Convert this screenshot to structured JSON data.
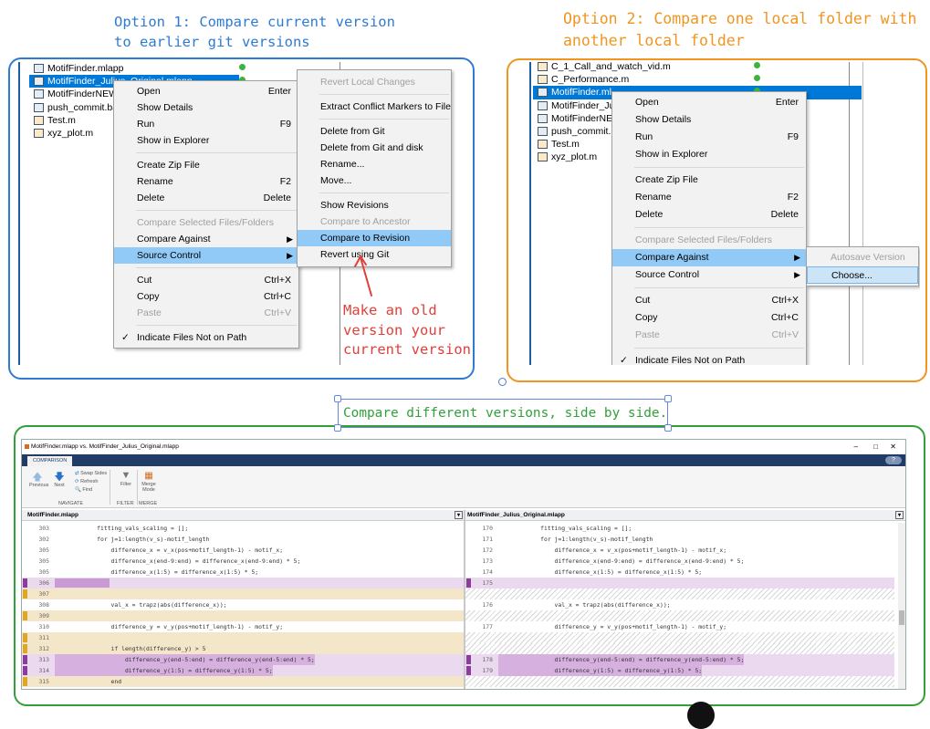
{
  "option1": {
    "line1": "Option 1: Compare current version",
    "line2": "to earlier git versions",
    "color": "#2e7bd4"
  },
  "option2": {
    "line1": "Option 2: Compare one local folder with",
    "line2": "another local folder",
    "color": "#f0951f"
  },
  "option3": {
    "label": "Compare different versions, side by side.",
    "color": "#32a03a"
  },
  "annotation": {
    "line1": "Make an old",
    "line2": "version your",
    "line3": "current version",
    "color": "#e0403a"
  },
  "panel1": {
    "files": [
      "MotifFinder.mlapp",
      "MotifFinder_Julius_Original.mlapp",
      "MotifFinderNEW",
      "push_commit.ba",
      "Test.m",
      "xyz_plot.m"
    ],
    "menu": {
      "open": "Open",
      "open_sc": "Enter",
      "show_details": "Show Details",
      "run": "Run",
      "run_sc": "F9",
      "show_explorer": "Show in Explorer",
      "create_zip": "Create Zip File",
      "rename": "Rename",
      "rename_sc": "F2",
      "delete": "Delete",
      "delete_sc": "Delete",
      "compare_selected": "Compare Selected Files/Folders",
      "compare_against": "Compare Against",
      "source_control": "Source Control",
      "cut": "Cut",
      "cut_sc": "Ctrl+X",
      "copy": "Copy",
      "copy_sc": "Ctrl+C",
      "paste": "Paste",
      "paste_sc": "Ctrl+V",
      "indicate": "Indicate Files Not on Path"
    },
    "submenu": {
      "revert_local": "Revert Local Changes",
      "extract_conflict": "Extract Conflict Markers to File",
      "delete_git": "Delete from Git",
      "delete_git_disk": "Delete from Git and disk",
      "rename": "Rename...",
      "move": "Move...",
      "show_revisions": "Show Revisions",
      "compare_ancestor": "Compare to Ancestor",
      "compare_revision": "Compare to Revision",
      "revert_git": "Revert using Git"
    }
  },
  "panel2": {
    "files": [
      "C_1_Call_and_watch_vid.m",
      "C_Performance.m",
      "MotifFinder.ml",
      "MotifFinder_Ju",
      "MotifFinderNE",
      "push_commit.l",
      "Test.m",
      "xyz_plot.m"
    ],
    "menu": {
      "open": "Open",
      "open_sc": "Enter",
      "show_details": "Show Details",
      "run": "Run",
      "run_sc": "F9",
      "show_explorer": "Show in Explorer",
      "create_zip": "Create Zip File",
      "rename": "Rename",
      "rename_sc": "F2",
      "delete": "Delete",
      "delete_sc": "Delete",
      "compare_selected": "Compare Selected Files/Folders",
      "compare_against": "Compare Against",
      "source_control": "Source Control",
      "cut": "Cut",
      "cut_sc": "Ctrl+X",
      "copy": "Copy",
      "copy_sc": "Ctrl+C",
      "paste": "Paste",
      "paste_sc": "Ctrl+V",
      "indicate": "Indicate Files Not on Path"
    },
    "submenu": {
      "autosave": "Autosave Version",
      "choose": "Choose..."
    }
  },
  "compare_window": {
    "title": "MotifFinder.mlapp vs. MotifFinder_Julius_Original.mlapp",
    "tab": "COMPARISON",
    "toolbar": {
      "previous": "Previous",
      "next": "Next",
      "swap_sides": "Swap Sides",
      "refresh": "Refresh",
      "find": "Find",
      "filter": "Filter",
      "merge_mode": "Merge Mode",
      "group_navigate": "NAVIGATE",
      "group_filter": "FILTER",
      "group_merge": "MERGE"
    },
    "left_file": "MotifFinder.mlapp",
    "right_file": "MotifFinder_Julius_Original.mlapp",
    "left_lines": [
      {
        "n": "303",
        "code": "            fitting_vals_scaling = [];",
        "kind": "normal"
      },
      {
        "n": "302",
        "code": "            for j=1:length(v_s)-motif_length",
        "kind": "normal"
      },
      {
        "n": "305",
        "code": "                difference_x = v_x(pos+motif_length-1) - motif_x;",
        "kind": "normal"
      },
      {
        "n": "305",
        "code": "                difference_x(end-9:end) = difference_x(end-9:end) * 5;",
        "kind": "normal"
      },
      {
        "n": "305",
        "code": "                difference_x(1:5) = difference_x(1:5) * 5;",
        "kind": "normal"
      },
      {
        "n": "306",
        "code": "",
        "kind": "mod"
      },
      {
        "n": "307",
        "code": "",
        "kind": "ins"
      },
      {
        "n": "308",
        "code": "                val_x = trapz(abs(difference_x));",
        "kind": "normal"
      },
      {
        "n": "309",
        "code": "",
        "kind": "ins"
      },
      {
        "n": "310",
        "code": "                difference_y = v_y(pos+motif_length-1) - motif_y;",
        "kind": "normal"
      },
      {
        "n": "311",
        "code": "",
        "kind": "ins"
      },
      {
        "n": "312",
        "code": "                if length(difference_y) > 5",
        "kind": "ins"
      },
      {
        "n": "313",
        "code": "                    difference_y(end-5:end) = difference_y(end-5:end) * 5;",
        "kind": "mod"
      },
      {
        "n": "314",
        "code": "                    difference_y(1:5) = difference_y(1:5) * 5;",
        "kind": "mod"
      },
      {
        "n": "315",
        "code": "                end",
        "kind": "ins"
      }
    ],
    "right_lines": [
      {
        "n": "170",
        "code": "            fitting_vals_scaling = [];",
        "kind": "normal"
      },
      {
        "n": "171",
        "code": "            for j=1:length(v_s)-motif_length",
        "kind": "normal"
      },
      {
        "n": "172",
        "code": "                difference_x = v_x(pos+motif_length-1) - motif_x;",
        "kind": "normal"
      },
      {
        "n": "173",
        "code": "                difference_x(end-9:end) = difference_x(end-9:end) * 5;",
        "kind": "normal"
      },
      {
        "n": "174",
        "code": "                difference_x(1:5) = difference_x(1:5) * 5;",
        "kind": "normal"
      },
      {
        "n": "175",
        "code": "",
        "kind": "mod"
      },
      {
        "n": "",
        "code": "",
        "kind": "hatch"
      },
      {
        "n": "176",
        "code": "                val_x = trapz(abs(difference_x));",
        "kind": "normal"
      },
      {
        "n": "",
        "code": "",
        "kind": "hatch"
      },
      {
        "n": "177",
        "code": "                difference_y = v_y(pos+motif_length-1) - motif_y;",
        "kind": "normal"
      },
      {
        "n": "",
        "code": "",
        "kind": "hatch"
      },
      {
        "n": "",
        "code": "",
        "kind": "hatch"
      },
      {
        "n": "178",
        "code": "                difference_y(end-5:end) = difference_y(end-5:end) * 5;",
        "kind": "mod"
      },
      {
        "n": "179",
        "code": "                difference_y(1:5) = difference_y(1:5) * 5;",
        "kind": "mod"
      },
      {
        "n": "",
        "code": "",
        "kind": "hatch"
      }
    ]
  }
}
